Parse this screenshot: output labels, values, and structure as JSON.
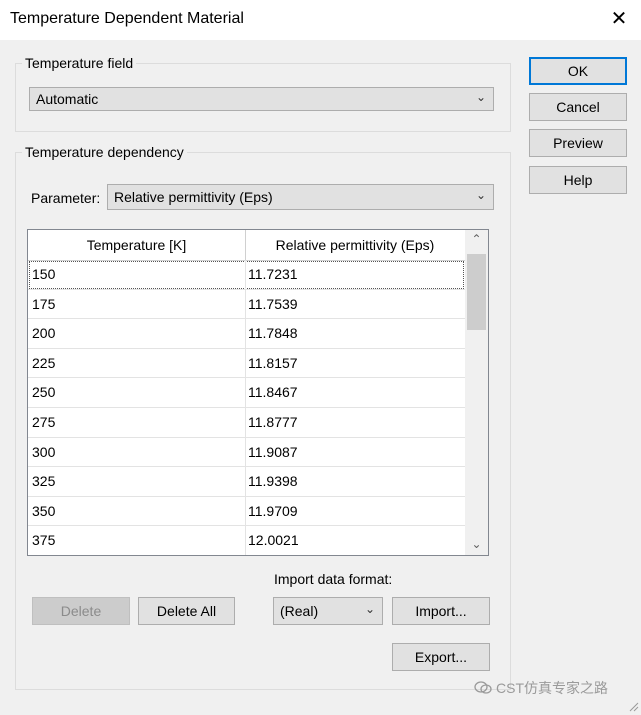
{
  "window": {
    "title": "Temperature Dependent Material",
    "close_glyph": "✕"
  },
  "temperature_field": {
    "legend": "Temperature field",
    "selected": "Automatic"
  },
  "temperature_dependency": {
    "legend": "Temperature dependency",
    "parameter_label": "Parameter:",
    "parameter_selected": "Relative permittivity (Eps)"
  },
  "table": {
    "headers": [
      "Temperature [K]",
      "Relative permittivity (Eps)"
    ],
    "rows": [
      [
        "150",
        "11.7231"
      ],
      [
        "175",
        "11.7539"
      ],
      [
        "200",
        "11.7848"
      ],
      [
        "225",
        "11.8157"
      ],
      [
        "250",
        "11.8467"
      ],
      [
        "275",
        "11.8777"
      ],
      [
        "300",
        "11.9087"
      ],
      [
        "325",
        "11.9398"
      ],
      [
        "350",
        "11.9709"
      ],
      [
        "375",
        "12.0021"
      ]
    ]
  },
  "buttons": {
    "ok": "OK",
    "cancel": "Cancel",
    "preview": "Preview",
    "help": "Help",
    "delete": "Delete",
    "delete_all": "Delete All",
    "import": "Import...",
    "export": "Export..."
  },
  "import_format": {
    "label": "Import data format:",
    "selected": "(Real)"
  },
  "watermark": {
    "text": "CST仿真专家之路"
  },
  "icons": {
    "close": "close-icon",
    "dropdown": "chevron-down-icon",
    "scroll_up": "scroll-up-icon",
    "scroll_down": "scroll-down-icon",
    "resize": "resize-grip-icon"
  }
}
